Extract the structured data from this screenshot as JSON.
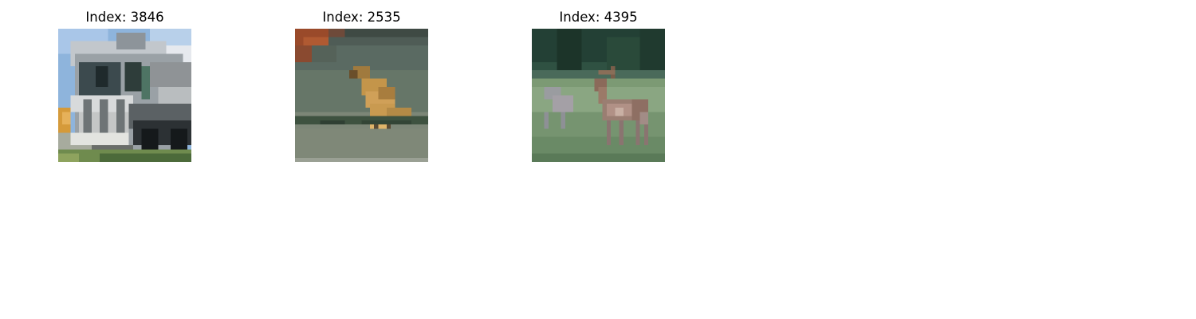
{
  "figure": {
    "panels": [
      {
        "title": "Index: 3846",
        "image_subject": "truck-photo"
      },
      {
        "title": "Index: 2535",
        "image_subject": "bird-photo"
      },
      {
        "title": "Index: 4395",
        "image_subject": "deer-photo"
      }
    ]
  }
}
